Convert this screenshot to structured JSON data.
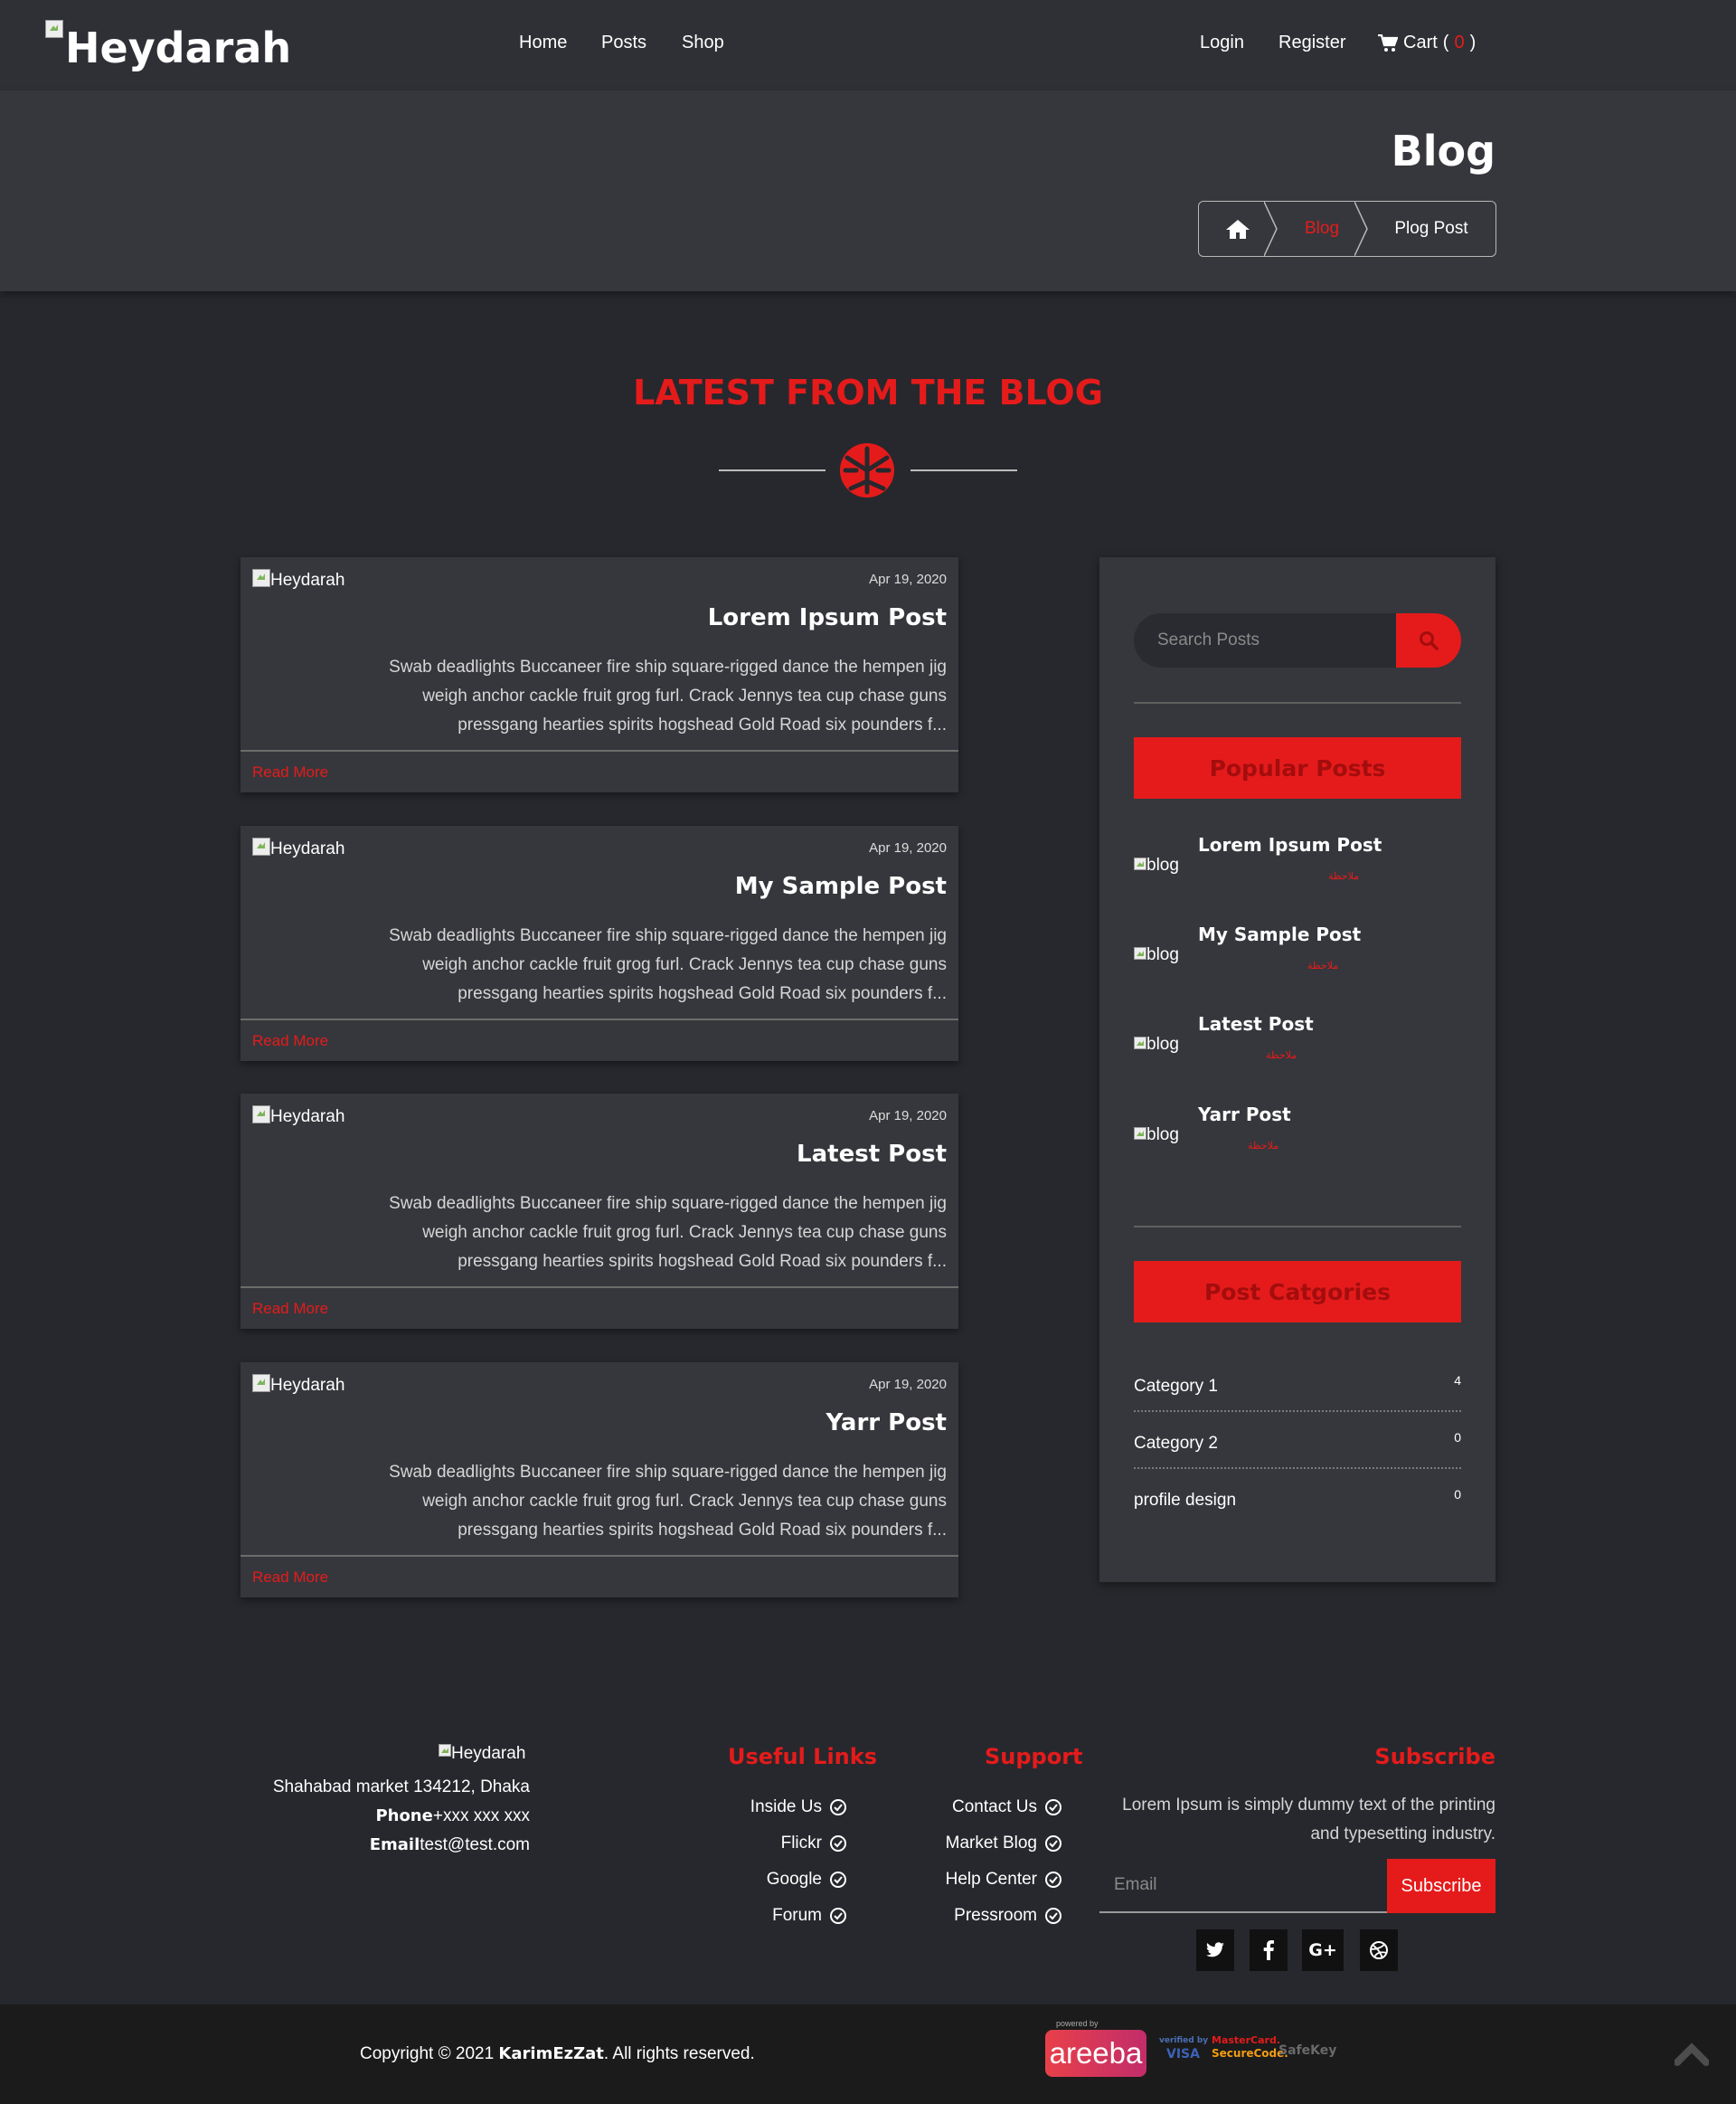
{
  "brand": {
    "name": "Heydarah"
  },
  "nav": {
    "left": [
      "Home",
      "Posts",
      "Shop"
    ],
    "login": "Login",
    "register": "Register",
    "cart_label": "Cart",
    "cart_open": "(",
    "cart_count": "0",
    "cart_close": ")"
  },
  "banner": {
    "title": "Blog",
    "breadcrumb": {
      "home_icon": "home-icon",
      "blog": "Blog",
      "current": "Plog Post"
    }
  },
  "section": {
    "title": "LATEST FROM THE BLOG"
  },
  "posts": [
    {
      "img_alt": "Heydarah",
      "date": "Apr 19, 2020",
      "title": "Lorem Ipsum Post",
      "excerpt": "Swab deadlights Buccaneer fire ship square-rigged dance the hempen jig weigh anchor cackle fruit grog furl. Crack Jennys tea cup chase guns pressgang hearties spirits hogshead Gold Road six pounders f...",
      "read_more": "Read More"
    },
    {
      "img_alt": "Heydarah",
      "date": "Apr 19, 2020",
      "title": "My Sample Post",
      "excerpt": "Swab deadlights Buccaneer fire ship square-rigged dance the hempen jig weigh anchor cackle fruit grog furl. Crack Jennys tea cup chase guns pressgang hearties spirits hogshead Gold Road six pounders f...",
      "read_more": "Read More"
    },
    {
      "img_alt": "Heydarah",
      "date": "Apr 19, 2020",
      "title": "Latest Post",
      "excerpt": "Swab deadlights Buccaneer fire ship square-rigged dance the hempen jig weigh anchor cackle fruit grog furl. Crack Jennys tea cup chase guns pressgang hearties spirits hogshead Gold Road six pounders f...",
      "read_more": "Read More"
    },
    {
      "img_alt": "Heydarah",
      "date": "Apr 19, 2020",
      "title": "Yarr Post",
      "excerpt": "Swab deadlights Buccaneer fire ship square-rigged dance the hempen jig weigh anchor cackle fruit grog furl. Crack Jennys tea cup chase guns pressgang hearties spirits hogshead Gold Road six pounders f...",
      "read_more": "Read More"
    }
  ],
  "sidebar": {
    "search_placeholder": "Search Posts",
    "popular_heading": "Popular Posts",
    "popular": [
      {
        "img_alt": "blog",
        "title": "Lorem Ipsum Post",
        "meta": "ملاحظة"
      },
      {
        "img_alt": "blog",
        "title": "My Sample Post",
        "meta": "ملاحظة"
      },
      {
        "img_alt": "blog",
        "title": "Latest Post",
        "meta": "ملاحظة"
      },
      {
        "img_alt": "blog",
        "title": "Yarr Post",
        "meta": "ملاحظة"
      }
    ],
    "categories_heading": "Post Catgories",
    "categories": [
      {
        "name": "Category 1",
        "count": "4"
      },
      {
        "name": "Category 2",
        "count": "0"
      },
      {
        "name": "profile design",
        "count": "0"
      }
    ]
  },
  "footer": {
    "logo_alt": "Heydarah",
    "address": "Shahabad market 134212, Dhaka",
    "phone_label": "Phone",
    "phone": "+xxx xxx xxx",
    "email_label": "Email",
    "email": "test@test.com",
    "useful_heading": "Useful Links",
    "useful_links": [
      "Inside Us",
      "Flickr",
      "Google",
      "Forum"
    ],
    "support_heading": "Support",
    "support_links": [
      "Contact Us",
      "Market Blog",
      "Help Center",
      "Pressroom"
    ],
    "subscribe_heading": "Subscribe",
    "subscribe_text": "Lorem Ipsum is simply dummy text of the printing and typesetting industry.",
    "email_placeholder": "Email",
    "subscribe_button": "Subscribe",
    "social": [
      "twitter-icon",
      "facebook-icon",
      "google-plus-icon",
      "dribbble-icon"
    ],
    "social_gplus_text": "G+"
  },
  "bottom": {
    "copyright_prefix": "Copyright © 2021 ",
    "copyright_owner": "KarimEzZat",
    "copyright_suffix": ". All rights reserved.",
    "powered_by": "powered by",
    "areeba": "areeba",
    "visa_top": "verified by",
    "visa": "VISA",
    "mastercard_top": "MasterCard.",
    "mastercard": "SecureCode.",
    "safekey": "SafeKey"
  },
  "colors": {
    "accent": "#e51b1b",
    "navbar": "#2f3035",
    "page": "#27282d",
    "card": "#36373c",
    "bottom_bar": "#1b1b1b"
  }
}
